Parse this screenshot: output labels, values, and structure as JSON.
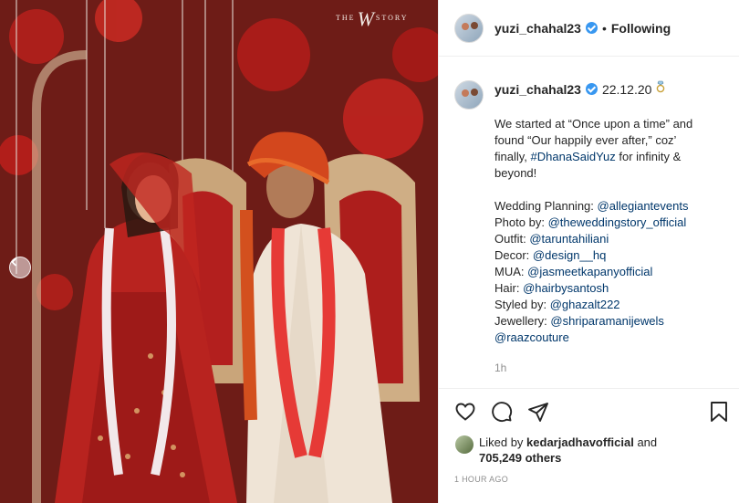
{
  "photo": {
    "watermark_left": "THE",
    "watermark_mid": "W",
    "watermark_right": "STORY"
  },
  "header": {
    "username": "yuzi_chahal23",
    "separator": "•",
    "follow_label": "Following"
  },
  "caption": {
    "username": "yuzi_chahal23",
    "date": "22.12.20",
    "ring_icon": "ring-emoji",
    "text_lines": [
      "We started at “Once upon a time” and",
      "found “Our happily ever after,” coz’",
      "finally,",
      "for infinity &",
      "beyond!"
    ],
    "hashtag": "#DhanaSaidYuz",
    "credits": [
      {
        "label": "Wedding Planning:",
        "handle": "@allegiantevents"
      },
      {
        "label": "Photo by:",
        "handle": "@theweddingstory_official"
      },
      {
        "label": "Outfit:",
        "handle": "@taruntahiliani"
      },
      {
        "label": "Decor:",
        "handle": "@design__hq"
      },
      {
        "label": "MUA:",
        "handle": "@jasmeetkapanyofficial"
      },
      {
        "label": "Hair:",
        "handle": "@hairbysantosh"
      },
      {
        "label": "Styled by:",
        "handle": "@ghazalt222"
      },
      {
        "label": "Jewellery:",
        "handle": "@shriparamanijewels"
      }
    ],
    "extra_handle": "@raazcouture",
    "age": "1h"
  },
  "likes": {
    "prefix": "Liked by",
    "user": "kedarjadhavofficial",
    "and": "and",
    "count": "705,249 others"
  },
  "timestamp": "1 HOUR AGO",
  "colors": {
    "link": "#00376b",
    "verified": "#3897f0",
    "muted": "#8e8e8e"
  }
}
